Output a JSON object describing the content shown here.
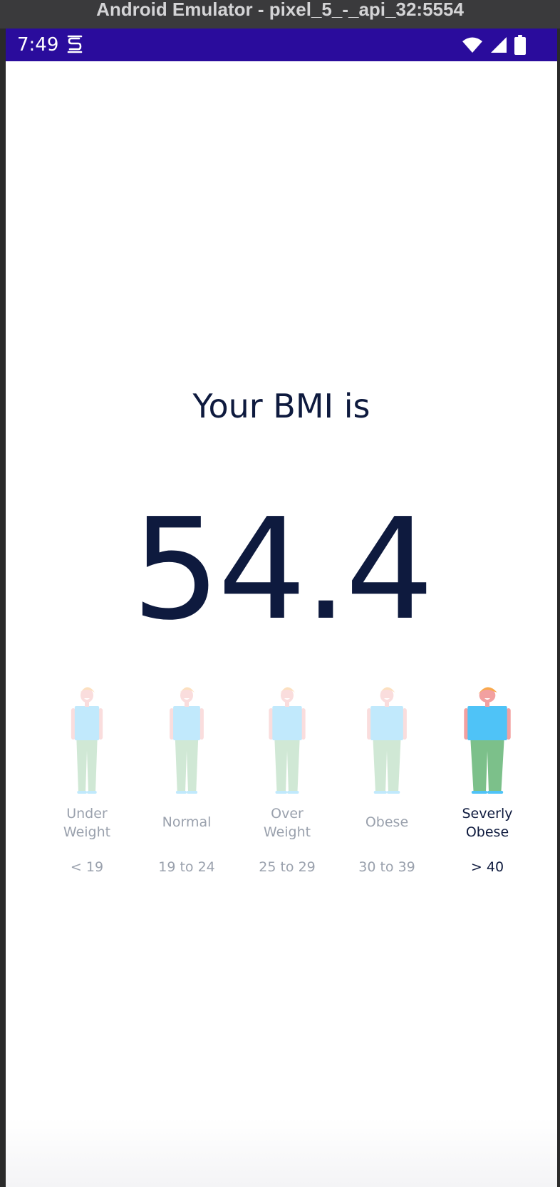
{
  "window": {
    "title": "Android Emulator - pixel_5_-_api_32:5554"
  },
  "status_bar": {
    "time": "7:49",
    "icons": [
      "sync-s-icon",
      "wifi-icon",
      "signal-icon",
      "battery-icon"
    ],
    "color": "#2a0c9c"
  },
  "result": {
    "heading": "Your BMI is",
    "value": "54.4"
  },
  "categories": [
    {
      "label": "Under\nWeight",
      "range": "< 19",
      "active": false
    },
    {
      "label": "Normal",
      "range": "19 to 24",
      "active": false
    },
    {
      "label": "Over\nWeight",
      "range": "25 to 29",
      "active": false
    },
    {
      "label": "Obese",
      "range": "30 to 39",
      "active": false
    },
    {
      "label": "Severly\nObese",
      "range": "> 40",
      "active": true
    }
  ],
  "colors": {
    "text_dark": "#0e1a3e",
    "text_muted": "#9aa1ad",
    "shirt": "#4fc3f7",
    "pants": "#7cc08a",
    "skin": "#f2a0a0",
    "hair": "#f9a94b"
  }
}
